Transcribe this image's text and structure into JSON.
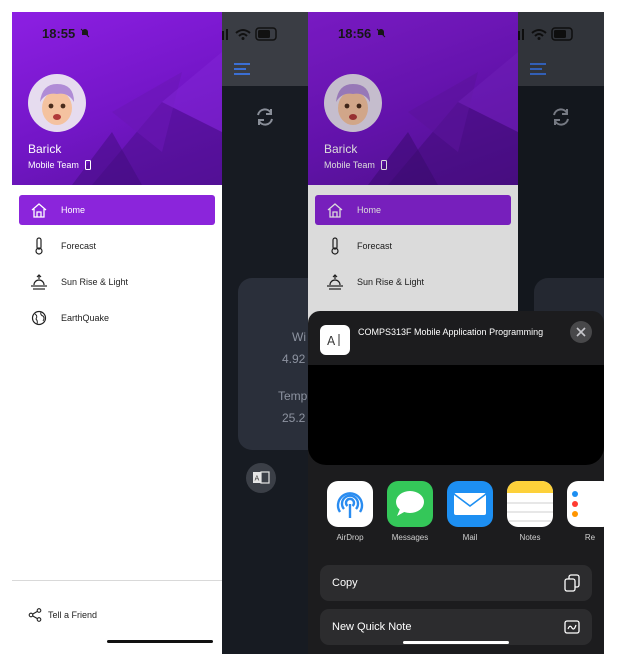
{
  "status": {
    "time_left": "18:55",
    "time_right": "18:56",
    "battery": "54"
  },
  "user": {
    "name": "Barick",
    "team": "Mobile Team"
  },
  "nav_items": [
    {
      "label": "Home",
      "icon": "home-icon",
      "active": true
    },
    {
      "label": "Forecast",
      "icon": "thermometer-icon",
      "active": false
    },
    {
      "label": "Sun Rise & Light",
      "icon": "sunrise-icon",
      "active": false
    },
    {
      "label": "EarthQuake",
      "icon": "globe-icon",
      "active": false
    }
  ],
  "footer": {
    "tell_friend": "Tell a Friend"
  },
  "background_card": {
    "wind_label": "Wi",
    "wind_value": "4.92",
    "temp_label": "Temp",
    "temp_value": "25.2"
  },
  "share_sheet": {
    "title": "COMPS313F Mobile Application Programming",
    "doc_icon": "A̲",
    "apps": [
      {
        "label": "AirDrop",
        "icon": "airdrop-icon"
      },
      {
        "label": "Messages",
        "icon": "messages-icon"
      },
      {
        "label": "Mail",
        "icon": "mail-icon"
      },
      {
        "label": "Notes",
        "icon": "notes-icon"
      },
      {
        "label": "Re",
        "icon": "reminders-icon"
      }
    ],
    "actions": [
      {
        "label": "Copy",
        "icon": "copy-icon"
      },
      {
        "label": "New Quick Note",
        "icon": "quick-note-icon"
      }
    ]
  },
  "colors": {
    "accent": "#8b25db",
    "header_start": "#8d1fe3",
    "header_end": "#5a12a0",
    "sheet_bg": "#1c1c1e"
  }
}
